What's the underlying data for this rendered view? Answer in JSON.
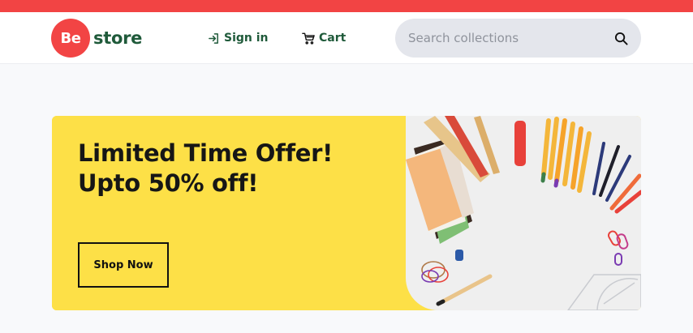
{
  "header": {
    "logo": {
      "badge_text": "Be",
      "text": "store"
    },
    "nav": {
      "sign_in_label": "Sign in",
      "cart_label": "Cart"
    },
    "search": {
      "placeholder": "Search collections",
      "value": ""
    }
  },
  "hero": {
    "title_line1": "Limited Time Offer!",
    "title_line2": "Upto 50% off!",
    "button_label": "Shop Now",
    "image_subject": "stationery flat-lay: pencils, pens, rulers, paper, paper clips, protractor"
  },
  "icons": {
    "sign_in": "sign-in-icon",
    "cart": "cart-icon",
    "search": "search-icon"
  },
  "colors": {
    "top_bar": "#f24444",
    "brand_red": "#f24444",
    "brand_green": "#1f5a3a",
    "hero_yellow": "#fde047",
    "search_bg": "#e4e6ec",
    "page_bg": "#f8f9fb"
  }
}
